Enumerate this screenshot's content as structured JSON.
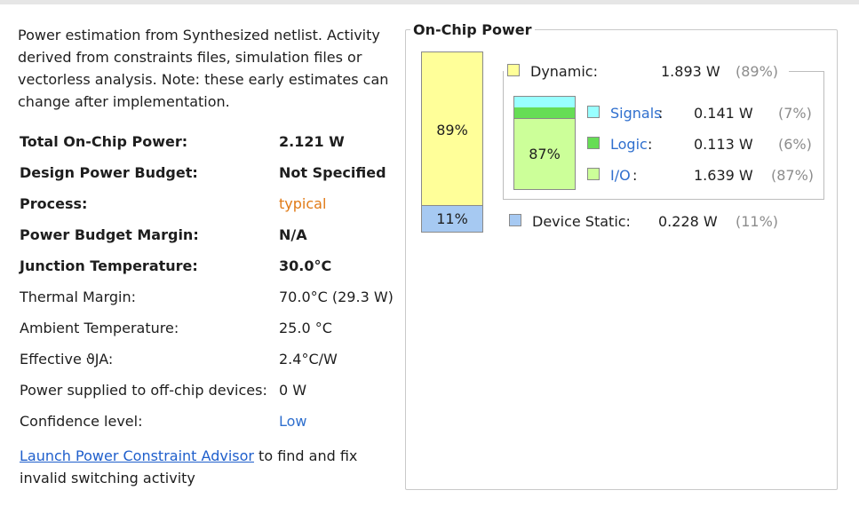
{
  "intro": "Power estimation from Synthesized netlist. Activity derived from constraints files, simulation files or vectorless analysis. Note: these early estimates can change after implementation.",
  "summary": [
    {
      "label": "Total On-Chip Power:",
      "value": "2.121 W",
      "bold": true
    },
    {
      "label": "Design Power Budget:",
      "value": "Not Specified",
      "bold": true
    },
    {
      "label": "Process:",
      "value": "typical",
      "bold": true,
      "value_color": "#e07a16"
    },
    {
      "label": "Power Budget Margin:",
      "value": "N/A",
      "bold": true
    },
    {
      "label": "Junction Temperature:",
      "value": "30.0°C",
      "bold": true
    },
    {
      "label": "Thermal Margin:",
      "value": "70.0°C (29.3 W)"
    },
    {
      "label": "Ambient Temperature:",
      "value": "25.0 °C"
    },
    {
      "label": "Effective ϑJA:",
      "value": "2.4°C/W"
    },
    {
      "label": "Power supplied to off-chip devices:",
      "value": "0 W"
    },
    {
      "label": "Confidence level:",
      "value": "Low",
      "value_color": "#2f6fce"
    }
  ],
  "advisor": {
    "link": "Launch Power Constraint Advisor",
    "text": " to find and fix invalid switching activity"
  },
  "panel": {
    "title": "On-Chip Power",
    "bar": {
      "dynamic_pct": "89%",
      "static_pct": "11%",
      "dynamic_fraction": 0.89,
      "static_fraction": 0.11
    },
    "subbar": {
      "io_pct": "87%",
      "signals_fraction": 0.07,
      "logic_fraction": 0.06,
      "io_fraction": 0.87
    },
    "dynamic": {
      "label": "Dynamic:",
      "value": "1.893 W",
      "pct": "(89%)",
      "color": "#ffff99"
    },
    "signals": {
      "label": "Signals",
      "colon": ":",
      "value": "0.141 W",
      "pct": "(7%)",
      "color": "#99ffff"
    },
    "logic": {
      "label": "Logic",
      "colon": ":",
      "value": "0.113 W",
      "pct": "(6%)",
      "color": "#66dd55"
    },
    "io": {
      "label": "I/O",
      "colon": ":",
      "value": "1.639 W",
      "pct": "(87%)",
      "color": "#ccff99"
    },
    "static": {
      "label": "Device Static:",
      "value": "0.228 W",
      "pct": "(11%)",
      "color": "#a6c9f2"
    }
  }
}
